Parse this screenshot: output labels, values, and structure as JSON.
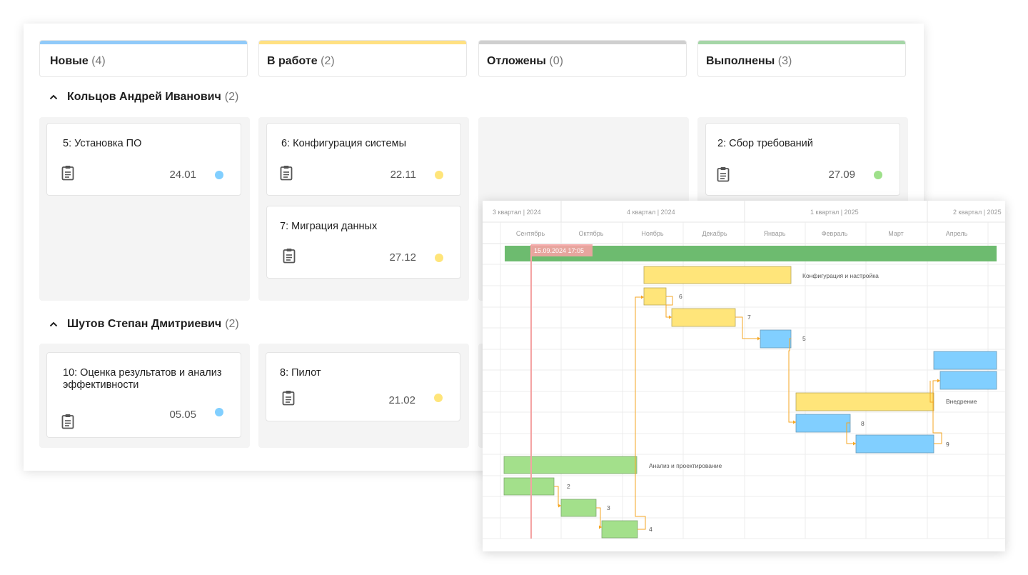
{
  "columns": [
    {
      "title": "Новые",
      "count": "(4)",
      "color": "#90caf9"
    },
    {
      "title": "В работе",
      "count": "(2)",
      "color": "#ffe082"
    },
    {
      "title": "Отложены",
      "count": "(0)",
      "color": "#cfcfcf"
    },
    {
      "title": "Выполнены",
      "count": "(3)",
      "color": "#a5d6a7"
    }
  ],
  "groups": [
    {
      "name": "Кольцов Андрей Иванович",
      "count": "(2)"
    },
    {
      "name": "Шутов Степан Дмитриевич",
      "count": "(2)"
    }
  ],
  "cards": [
    {
      "title": "5: Установка ПО",
      "date": "24.01",
      "color": "#81cfff"
    },
    {
      "title": "6: Конфигурация системы",
      "date": "22.11",
      "color": "#ffe57a"
    },
    {
      "title": "7: Миграция данных",
      "date": "27.12",
      "color": "#ffe57a"
    },
    {
      "title": "2: Сбор требований",
      "date": "27.09",
      "color": "#9ee08a"
    },
    {
      "title": "10: Оценка результатов и анализ эффективности",
      "date": "05.05",
      "color": "#81cfff"
    },
    {
      "title": "8: Пилот",
      "date": "21.02",
      "color": "#ffe57a"
    }
  ],
  "gantt": {
    "quarters": [
      "3 квартал | 2024",
      "4 квартал | 2024",
      "1 квартал | 2025",
      "2 квартал | 2025"
    ],
    "months": [
      "Сентябрь",
      "Октябрь",
      "Ноябрь",
      "Декабрь",
      "Январь",
      "Февраль",
      "Март",
      "Апрель"
    ],
    "today_marker": "15.09.2024 17:05",
    "bar_labels": {
      "config": "Конфигурация  и настройка",
      "t6": "6",
      "t7": "7",
      "t5": "5",
      "impl": "Внедрение",
      "t8": "8",
      "t9": "9",
      "analysis": "Анализ и проектирование",
      "t2": "2",
      "t3": "3",
      "t4": "4"
    },
    "colors": {
      "green": "#6dbb6f",
      "lightgreen": "#a3e08b",
      "yellow": "#ffe57a",
      "blue": "#81cfff",
      "today": "#f4a3a3",
      "link": "#f5a623"
    }
  }
}
